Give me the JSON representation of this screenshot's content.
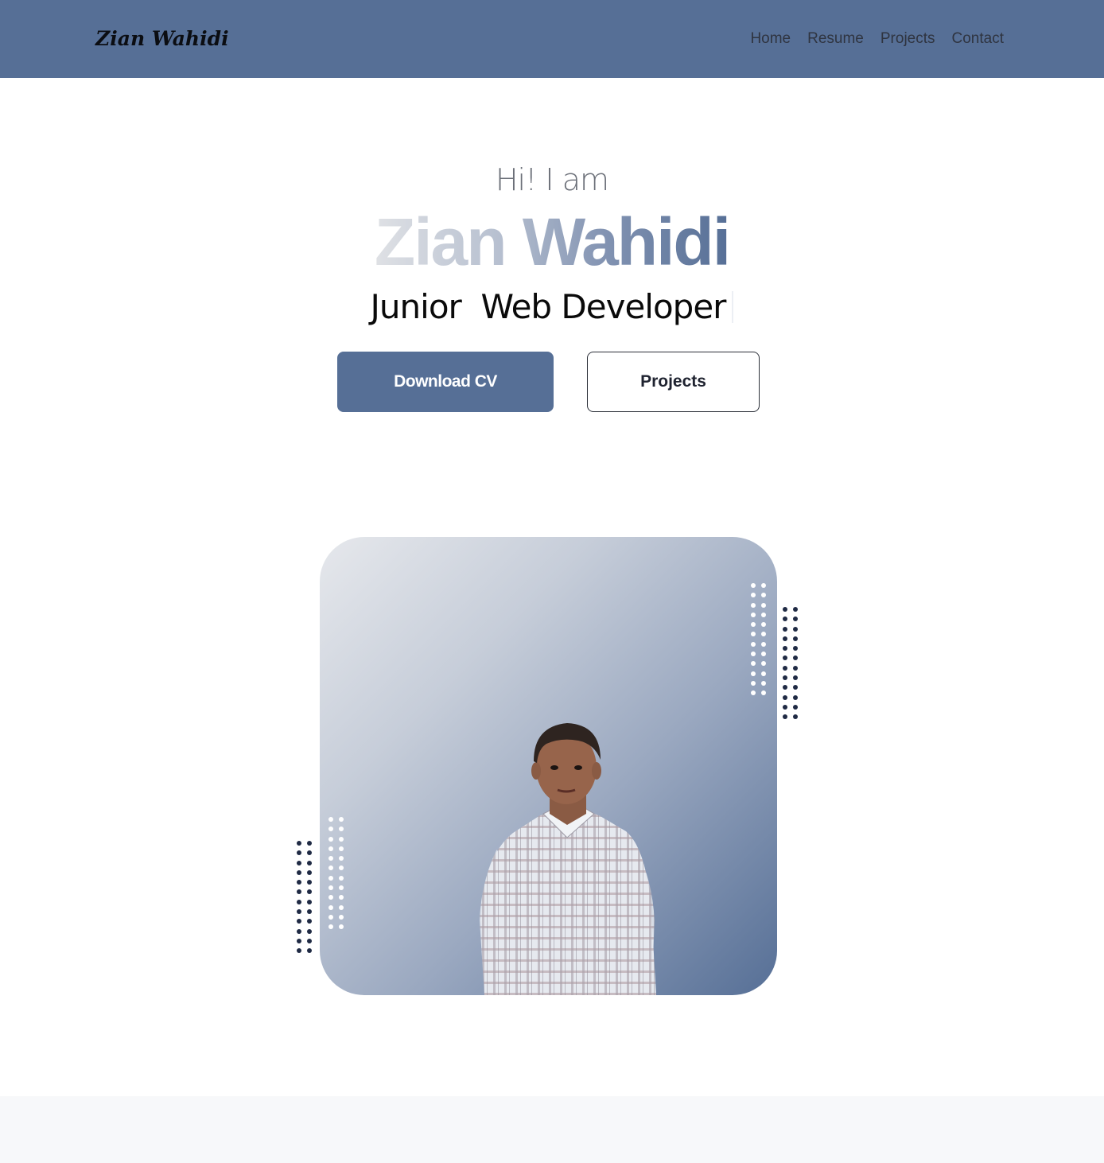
{
  "navbar": {
    "brand": "Zian Wahidi",
    "links": [
      "Home",
      "Resume",
      "Projects",
      "Contact"
    ],
    "background": "#566f96"
  },
  "hero": {
    "greeting": "Hi! I am",
    "name": "Zian Wahidi",
    "role": "Junior  Web Developer",
    "buttons": {
      "primary": "Download CV",
      "secondary": "Projects"
    }
  },
  "photo": {
    "gradient_start": "#e6e8ec",
    "gradient_end": "#566f96",
    "dot_colors": {
      "light": "#ffffff",
      "dark": "#1f2a44"
    }
  }
}
